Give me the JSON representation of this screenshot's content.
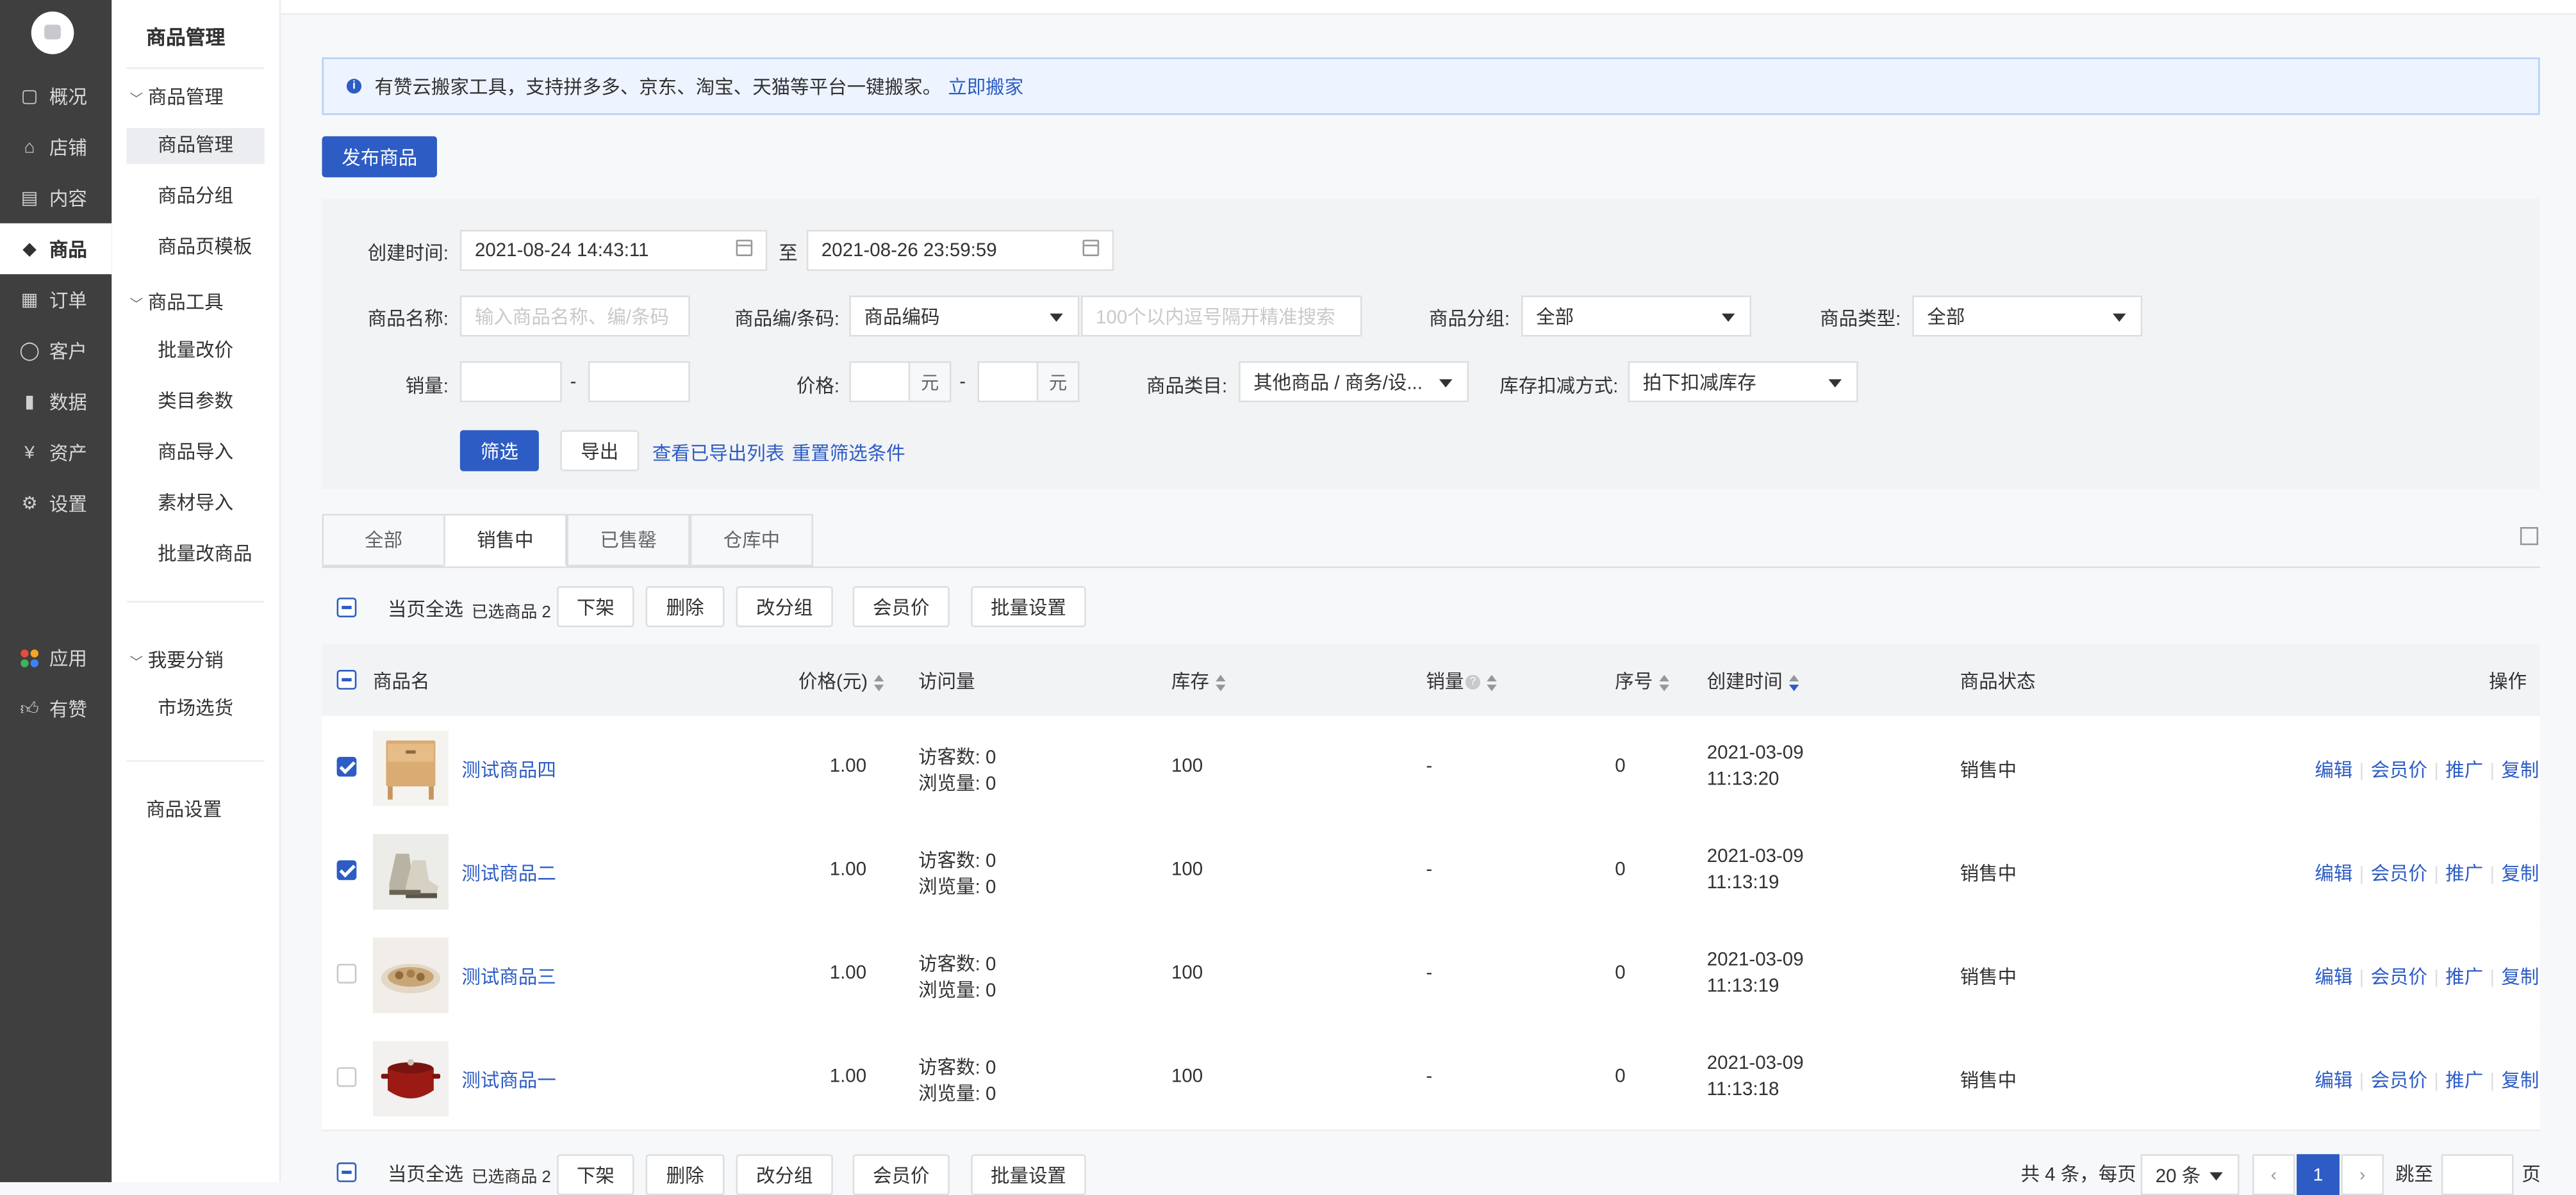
{
  "primary_nav": [
    {
      "label": "概况",
      "icon": "dashboard-icon"
    },
    {
      "label": "店铺",
      "icon": "store-icon"
    },
    {
      "label": "内容",
      "icon": "content-icon"
    },
    {
      "label": "商品",
      "icon": "tag-icon",
      "active": true
    },
    {
      "label": "订单",
      "icon": "order-icon"
    },
    {
      "label": "客户",
      "icon": "user-icon"
    },
    {
      "label": "数据",
      "icon": "bar-chart-icon"
    },
    {
      "label": "资产",
      "icon": "yen-icon"
    },
    {
      "label": "设置",
      "icon": "gear-icon"
    },
    {
      "label": "应用",
      "icon": "apps-icon"
    },
    {
      "label": "有赞",
      "icon": "thumb-up-icon"
    }
  ],
  "secondary_nav": {
    "title": "商品管理",
    "group1": "商品管理",
    "group1_items": [
      "商品管理",
      "商品分组",
      "商品页模板"
    ],
    "group2": "商品工具",
    "group2_items": [
      "批量改价",
      "类目参数",
      "商品导入",
      "素材导入",
      "批量改商品"
    ],
    "group3": "我要分销",
    "group3_items": [
      "市场选货"
    ],
    "settings": "商品设置"
  },
  "notice": {
    "text": "有赞云搬家工具，支持拼多多、京东、淘宝、天猫等平台一键搬家。",
    "link": "立即搬家"
  },
  "publish_button": "发布商品",
  "filters": {
    "created_label": "创建时间:",
    "created_from": "2021-08-24 14:43:11",
    "created_to_sep": "至",
    "created_to": "2021-08-26 23:59:59",
    "name_label": "商品名称:",
    "name_placeholder": "输入商品名称、编/条码",
    "code_label": "商品编/条码:",
    "code_select": "商品编码",
    "code_placeholder": "100个以内逗号隔开精准搜索",
    "group_label": "商品分组:",
    "group_select": "全部",
    "type_label": "商品类型:",
    "type_select": "全部",
    "sales_label": "销量:",
    "dash": "-",
    "price_label": "价格:",
    "unit": "元",
    "category_label": "商品类目:",
    "category_select": "其他商品 / 商务/设...",
    "stock_label": "库存扣减方式:",
    "stock_select": "拍下扣减库存",
    "filter_button": "筛选",
    "export_button": "导出",
    "view_exports": "查看已导出列表",
    "reset": "重置筛选条件"
  },
  "tabs": [
    "全部",
    "销售中",
    "已售罄",
    "仓库中"
  ],
  "bulk": {
    "select_page": "当页全选",
    "selected": "已选商品 2",
    "actions": [
      "下架",
      "删除",
      "改分组",
      "会员价",
      "批量设置"
    ]
  },
  "table": {
    "headers": {
      "name": "商品名",
      "price": "价格(元)",
      "visits": "访问量",
      "stock": "库存",
      "sales": "销量",
      "seq": "序号",
      "created": "创建时间",
      "status": "商品状态",
      "ops": "操作"
    },
    "visitor_prefix": "访客数: ",
    "view_prefix": "浏览量: ",
    "ops": [
      "编辑",
      "会员价",
      "推广",
      "复制"
    ],
    "rows": [
      {
        "checked": true,
        "name": "测试商品四",
        "price": "1.00",
        "visitors": "0",
        "views": "0",
        "stock": "100",
        "sales": "-",
        "seq": "0",
        "date": "2021-03-09",
        "time": "11:13:20",
        "status": "销售中",
        "thumb": "nightstand"
      },
      {
        "checked": true,
        "name": "测试商品二",
        "price": "1.00",
        "visitors": "0",
        "views": "0",
        "stock": "100",
        "sales": "-",
        "seq": "0",
        "date": "2021-03-09",
        "time": "11:13:19",
        "status": "销售中",
        "thumb": "shoes"
      },
      {
        "checked": false,
        "name": "测试商品三",
        "price": "1.00",
        "visitors": "0",
        "views": "0",
        "stock": "100",
        "sales": "-",
        "seq": "0",
        "date": "2021-03-09",
        "time": "11:13:19",
        "status": "销售中",
        "thumb": "food-plate"
      },
      {
        "checked": false,
        "name": "测试商品一",
        "price": "1.00",
        "visitors": "0",
        "views": "0",
        "stock": "100",
        "sales": "-",
        "seq": "0",
        "date": "2021-03-09",
        "time": "11:13:18",
        "status": "销售中",
        "thumb": "red-pot"
      }
    ]
  },
  "pagination": {
    "total": "共 4 条，每页",
    "page_size": "20 条",
    "current": "1",
    "jump_label": "跳至",
    "page_suffix": "页"
  },
  "colors": {
    "primary": "#2d5cc4",
    "sidebar": "#3f3f3f"
  }
}
